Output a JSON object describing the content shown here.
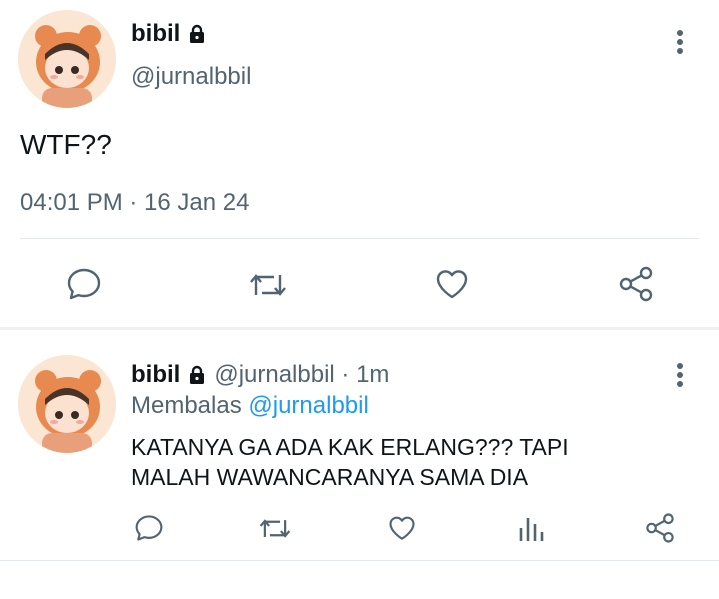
{
  "main_tweet": {
    "author_name": "bibil",
    "handle": "@jurnalbbil",
    "text": "WTF??",
    "timestamp": "04:01 PM · 16 Jan 24",
    "actions": [
      "reply-icon",
      "retweet-icon",
      "like-icon",
      "share-icon"
    ]
  },
  "reply_tweet": {
    "author_name": "bibil",
    "handle_time": "@jurnalbbil · 1m",
    "replying_prefix": "Membalas",
    "replying_to": "@jurnalbbil",
    "text_line1": "KATANYA GA ADA KAK ERLANG??? TAPI",
    "text_line2": "MALAH WAWANCARANYA SAMA DIA",
    "actions": [
      "reply-icon",
      "retweet-icon",
      "like-icon",
      "analytics-icon",
      "share-icon"
    ]
  },
  "colors": {
    "text": "#0f1419",
    "muted": "#536471",
    "link": "#1d9bf0",
    "divider": "#e6e9ec"
  }
}
